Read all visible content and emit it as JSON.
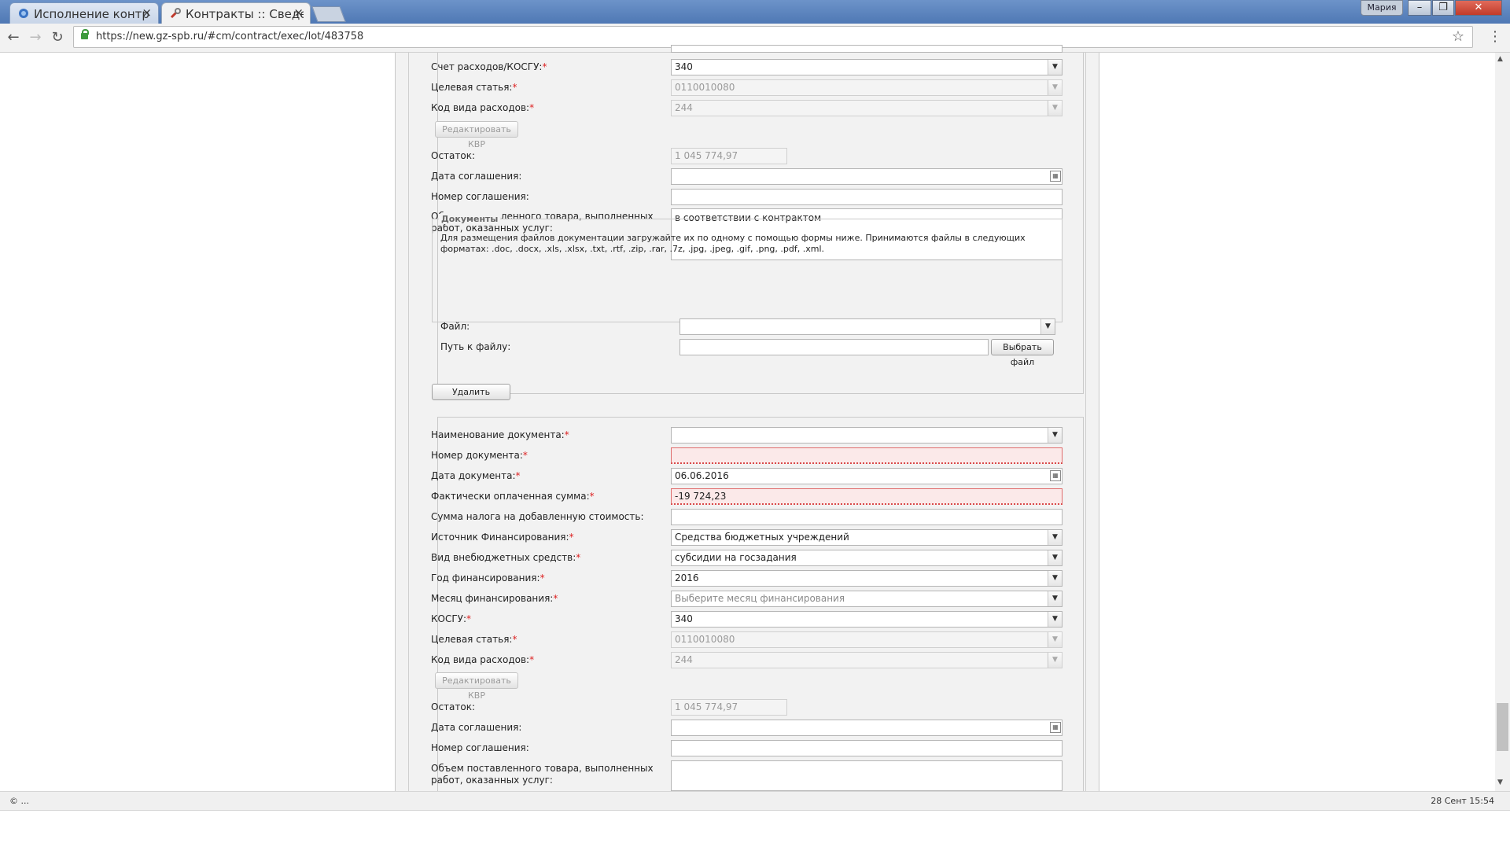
{
  "browser": {
    "tabs": [
      {
        "title": "Исполнение контр",
        "active": false
      },
      {
        "title": "Контракты :: Сведе",
        "active": true
      }
    ],
    "user": "Мария",
    "url": "https://new.gz-spb.ru/#cm/contract/exec/lot/483758"
  },
  "block1": {
    "account_label": "Счет расходов/КОСГУ:",
    "account_value": "340",
    "target_label": "Целевая статья:",
    "target_value": "0110010080",
    "expense_code_label": "Код вида расходов:",
    "expense_code_value": "244",
    "edit_kvr_button": "Редактировать КВР",
    "remainder_label": "Остаток:",
    "remainder_value": "1 045 774,97",
    "agreement_date_label": "Дата соглашения:",
    "agreement_date_value": "",
    "agreement_number_label": "Номер соглашения:",
    "agreement_number_value": "",
    "volume_label": "Объем поставленного товара, выполненных работ, оказанных услуг:",
    "volume_value": "в соответствии с контрактом",
    "documents": {
      "legend": "Документы",
      "info": "Для размещения файлов документации загружайте их по одному с помощью формы ниже. Принимаются файлы в следующих форматах: .doc, .docx, .xls, .xlsx, .txt, .rtf, .zip, .rar, .7z, .jpg, .jpeg, .gif, .png, .pdf, .xml.",
      "file_label": "Файл:",
      "path_label": "Путь к файлу:",
      "choose_button": "Выбрать файл"
    },
    "delete_button": "Удалить"
  },
  "block2": {
    "doc_name_label": "Наименование документа:",
    "doc_name_value": "",
    "doc_number_label": "Номер документа:",
    "doc_number_value": "",
    "doc_date_label": "Дата документа:",
    "doc_date_value": "06.06.2016",
    "paid_sum_label": "Фактически оплаченная сумма:",
    "paid_sum_value": "-19 724,23",
    "vat_label": "Сумма налога на добавленную стоимость:",
    "vat_value": "",
    "funding_source_label": "Источник Финансирования:",
    "funding_source_value": "Средства бюджетных учреждений",
    "extrabudget_label": "Вид внебюджетных средств:",
    "extrabudget_value": "субсидии на госзадания",
    "funding_year_label": "Год финансирования:",
    "funding_year_value": "2016",
    "funding_month_label": "Месяц финансирования:",
    "funding_month_value": "Выберите месяц финансирования",
    "kosgu_label": "КОСГУ:",
    "kosgu_value": "340",
    "target_label": "Целевая статья:",
    "target_value": "0110010080",
    "expense_code_label": "Код вида расходов:",
    "expense_code_value": "244",
    "edit_kvr_button": "Редактировать КВР",
    "remainder_label": "Остаток:",
    "remainder_value": "1 045 774,97",
    "agreement_date_label": "Дата соглашения:",
    "agreement_number_label": "Номер соглашения:",
    "volume_label": "Объем поставленного товара, выполненных работ, оказанных услуг:"
  },
  "statusbar": {
    "left": "© ...",
    "datetime": "28 Сент 15:54"
  },
  "colors": {
    "required": "#dd2222",
    "error_bg": "#fbe9e9",
    "page_bg": "#f2f2f2"
  }
}
